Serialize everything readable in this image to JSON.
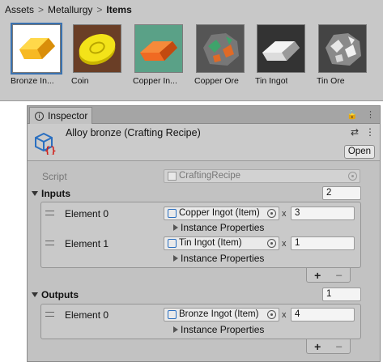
{
  "breadcrumb": {
    "items": [
      "Assets",
      "Metallurgy"
    ],
    "current": "Items",
    "separator": ">"
  },
  "assets": [
    {
      "label": "Bronze In...",
      "icon": "bronze-ingot-icon",
      "bg": "#ffffff",
      "selected": true
    },
    {
      "label": "Coin",
      "icon": "coin-icon",
      "bg": "#6a3e26"
    },
    {
      "label": "Copper In...",
      "icon": "copper-ingot-icon",
      "bg": "#5aa187"
    },
    {
      "label": "Copper Ore",
      "icon": "copper-ore-icon",
      "bg": "#555555"
    },
    {
      "label": "Tin Ingot",
      "icon": "tin-ingot-icon",
      "bg": "#333333"
    },
    {
      "label": "Tin Ore",
      "icon": "tin-ore-icon",
      "bg": "#444444"
    }
  ],
  "inspector": {
    "tab_label": "Inspector",
    "title": "Alloy bronze (Crafting Recipe)",
    "open_button": "Open",
    "script_label": "Script",
    "script_value": "CraftingRecipe",
    "inputs": {
      "label": "Inputs",
      "size": "2",
      "elements": [
        {
          "label": "Element 0",
          "item": "Copper Ingot (Item)",
          "qty": "3",
          "props_label": "Instance Properties"
        },
        {
          "label": "Element 1",
          "item": "Tin Ingot (Item)",
          "qty": "1",
          "props_label": "Instance Properties"
        }
      ]
    },
    "outputs": {
      "label": "Outputs",
      "size": "1",
      "elements": [
        {
          "label": "Element 0",
          "item": "Bronze Ingot (Item)",
          "qty": "4",
          "props_label": "Instance Properties"
        }
      ]
    },
    "x_char": "x",
    "plus": "+",
    "minus": "−",
    "lock_icon": "lock-icon",
    "menu_icon": "kebab-menu-icon",
    "settings_icon": "sliders-icon"
  }
}
